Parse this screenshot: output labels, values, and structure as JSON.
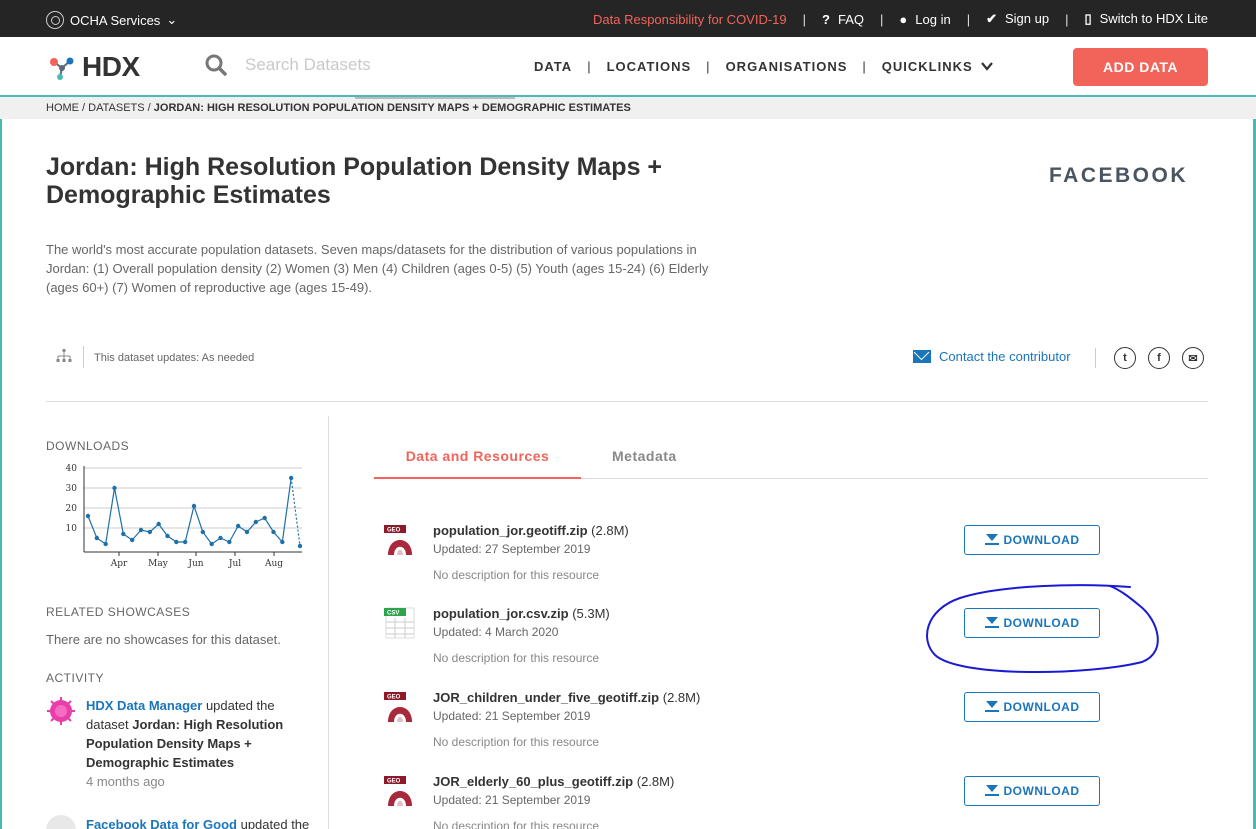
{
  "topbar": {
    "ocha_label": "OCHA Services",
    "covid_link": "Data Responsibility for COVID-19",
    "faq": "FAQ",
    "login": "Log in",
    "signup": "Sign up",
    "hdx_lite": "Switch to HDX Lite"
  },
  "header": {
    "logo_text": "HDX",
    "search_placeholder": "Search Datasets",
    "nav": [
      "DATA",
      "LOCATIONS",
      "ORGANISATIONS",
      "QUICKLINKS"
    ],
    "add_data": "ADD DATA"
  },
  "breadcrumb": {
    "home": "HOME",
    "datasets": "DATASETS",
    "current": "JORDAN: HIGH RESOLUTION POPULATION DENSITY MAPS + DEMOGRAPHIC ESTIMATES"
  },
  "dataset": {
    "title": "Jordan: High Resolution Population Density Maps + Demographic Estimates",
    "organisation": "FACEBOOK",
    "description": "The world's most accurate population datasets. Seven maps/datasets for the distribution of various populations in Jordan: (1) Overall population density (2) Women (3) Men (4) Children (ages 0-5) (5) Youth (ages 15-24) (6) Elderly (ages 60+) (7) Women of reproductive age (ages 15-49).",
    "update_frequency": "This dataset updates: As needed",
    "contact": "Contact the contributor"
  },
  "sidebar": {
    "downloads_heading": "DOWNLOADS",
    "related_heading": "RELATED SHOWCASES",
    "no_showcases": "There are no showcases for this dataset.",
    "activity_heading": "ACTIVITY",
    "activity": [
      {
        "actor": "HDX Data Manager",
        "verb": "updated the dataset",
        "target": "Jordan: High Resolution Population Density Maps + Demographic Estimates",
        "time": "4 months ago"
      },
      {
        "actor": "Facebook Data for Good",
        "verb": "updated the"
      }
    ]
  },
  "chart_data": {
    "type": "line",
    "y_ticks": [
      10,
      20,
      30,
      40
    ],
    "x_ticks": [
      "Apr",
      "May",
      "Jun",
      "Jul",
      "Aug"
    ],
    "ylim": [
      0,
      40
    ],
    "values": [
      16,
      5,
      2,
      30,
      7,
      4,
      9,
      8,
      12,
      6,
      3,
      3,
      21,
      8,
      2,
      5,
      3,
      11,
      8,
      13,
      15,
      8,
      3,
      35,
      1
    ],
    "grid": true
  },
  "tabs": {
    "active": "Data and Resources",
    "inactive": "Metadata"
  },
  "resources": [
    {
      "name": "population_jor.geotiff.zip",
      "size": "(2.8M)",
      "updated": "Updated: 27 September 2019",
      "desc": "No description for this resource",
      "type": "GEO",
      "button": "DOWNLOAD"
    },
    {
      "name": "population_jor.csv.zip",
      "size": "(5.3M)",
      "updated": "Updated: 4 March 2020",
      "desc": "No description for this resource",
      "type": "CSV",
      "button": "DOWNLOAD"
    },
    {
      "name": "JOR_children_under_five_geotiff.zip",
      "size": "(2.8M)",
      "updated": "Updated: 21 September 2019",
      "desc": "No description for this resource",
      "type": "GEO",
      "button": "DOWNLOAD"
    },
    {
      "name": "JOR_elderly_60_plus_geotiff.zip",
      "size": "(2.8M)",
      "updated": "Updated: 21 September 2019",
      "desc": "No description for this resource",
      "type": "GEO",
      "button": "DOWNLOAD"
    }
  ],
  "colors": {
    "accent": "#f2645a",
    "link": "#1b75bb",
    "teal": "#47bcb6",
    "annotation": "#1a1ad4"
  }
}
